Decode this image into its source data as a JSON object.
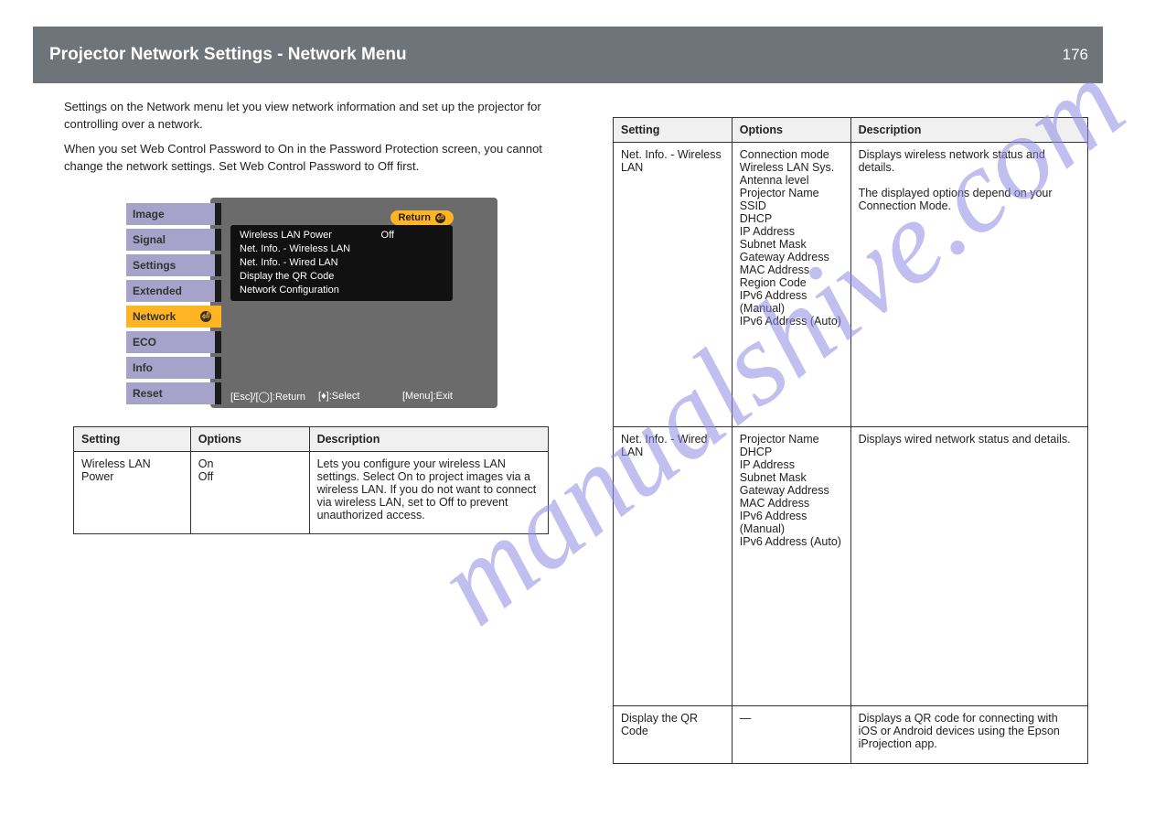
{
  "watermark_text": "manualshive.com",
  "header": {
    "title": "Projector Network Settings - Network Menu",
    "page_number": "176"
  },
  "left_column": {
    "intro": "Settings on the Network menu let you view network information and set up the projector for controlling over a network.",
    "more": [
      "When you set Web Control Password to On in the Password Protection screen, you cannot change the network settings. Set Web Control Password to Off first.",
      ""
    ]
  },
  "projector_ui": {
    "tabs": [
      "Image",
      "Signal",
      "Settings",
      "Extended",
      "Network",
      "ECO",
      "Info",
      "Reset"
    ],
    "selected_tab_index": 4,
    "return_label": "Return",
    "options": [
      {
        "label": "Wireless LAN Power",
        "value": "Off"
      },
      {
        "label": "Net. Info. - Wireless LAN",
        "value": ""
      },
      {
        "label": "Net. Info. - Wired LAN",
        "value": ""
      },
      {
        "label": "Display the QR Code",
        "value": ""
      },
      {
        "label": "Network Configuration",
        "value": ""
      }
    ],
    "footer_hints": [
      "[Esc]/[◯]:Return",
      "[♦]:Select",
      "[Menu]:Exit"
    ]
  },
  "left_table": {
    "headers": [
      "Setting",
      "Options",
      "Description"
    ],
    "row": {
      "setting": "Wireless LAN Power",
      "options": "On\nOff",
      "description": "Lets you configure your wireless LAN settings. Select On to project images via a wireless LAN. If you do not want to connect via wireless LAN, set to Off to prevent unauthorized access."
    }
  },
  "right_table": {
    "headers": [
      "Setting",
      "Options",
      "Description"
    ],
    "rows": [
      {
        "setting": "Net. Info. - Wireless LAN",
        "options": "Connection mode\nWireless LAN Sys.\nAntenna level\nProjector Name\nSSID\nDHCP\nIP Address\nSubnet Mask\nGateway Address\nMAC Address\nRegion Code\nIPv6 Address (Manual)\nIPv6 Address (Auto)",
        "description": "Displays wireless network status and details.\n\nThe displayed options depend on your Connection Mode."
      },
      {
        "setting": "Net. Info. - Wired LAN",
        "options": "Projector Name\nDHCP\nIP Address\nSubnet Mask\nGateway Address\nMAC Address\nIPv6 Address (Manual)\nIPv6 Address (Auto)",
        "description": "Displays wired network status and details."
      },
      {
        "setting": "Display the QR Code",
        "options": "—",
        "description": "Displays a QR code for connecting with iOS or Android devices using the Epson iProjection app."
      }
    ]
  }
}
